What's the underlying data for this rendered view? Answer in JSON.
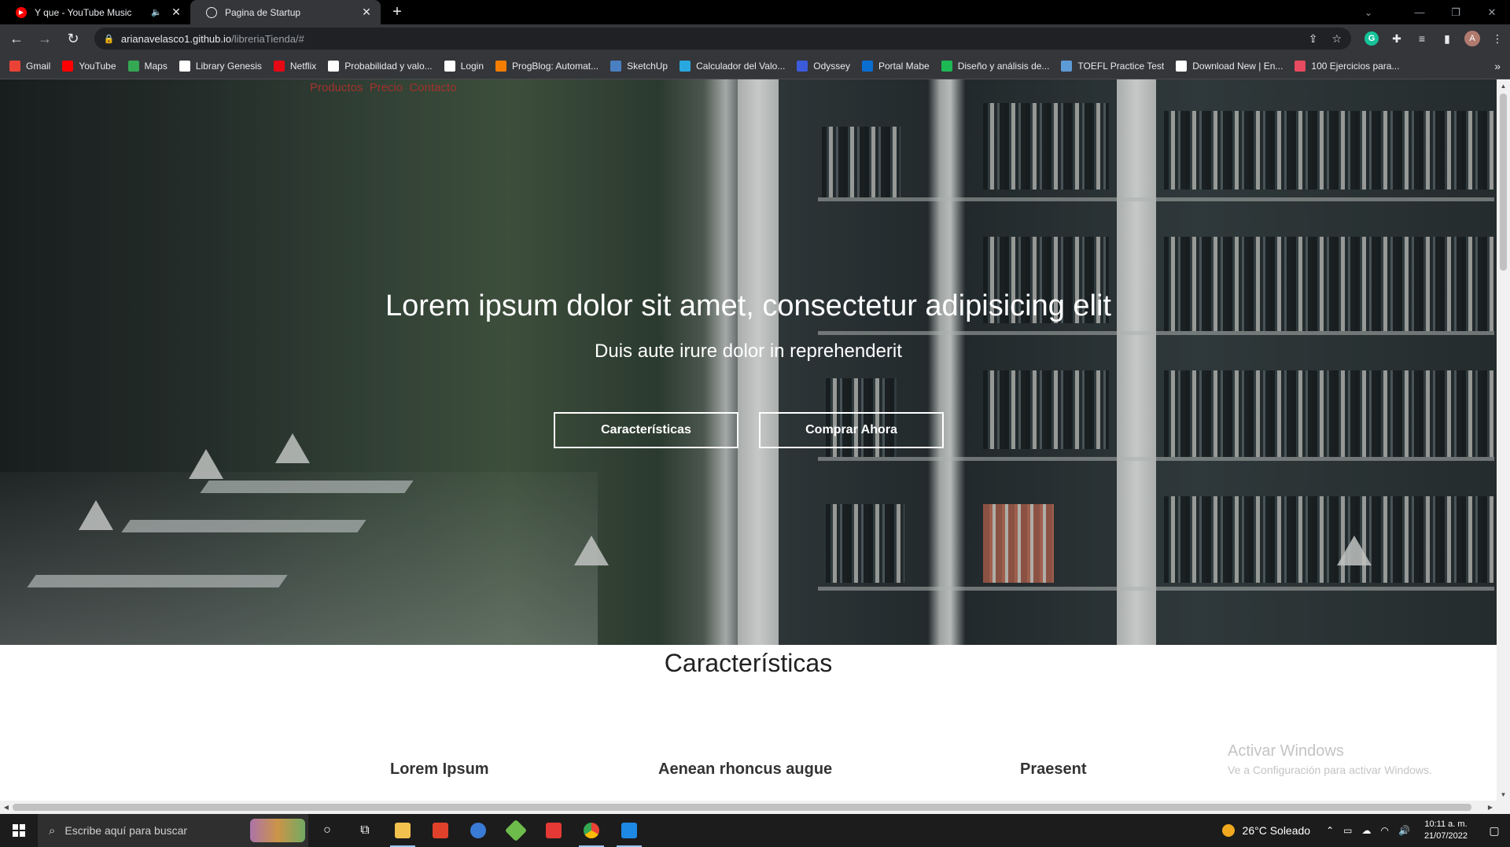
{
  "browser": {
    "tabs": [
      {
        "title": "Y que - YouTube Music",
        "favicon_color": "#ff0000",
        "audio": true
      },
      {
        "title": "Pagina de Startup",
        "favicon_color": "#e8eaed",
        "audio": false
      }
    ],
    "url_host": "arianavelasco1.github.io",
    "url_path": "/libreriaTienda/#",
    "bookmarks": [
      {
        "label": "Gmail",
        "icon": "gmail-icon",
        "color": "#ea4335"
      },
      {
        "label": "YouTube",
        "icon": "youtube-icon",
        "color": "#ff0000"
      },
      {
        "label": "Maps",
        "icon": "maps-icon",
        "color": "#34a853"
      },
      {
        "label": "Library Genesis",
        "icon": "library-genesis-icon",
        "color": "#ffffff"
      },
      {
        "label": "Netflix",
        "icon": "netflix-icon",
        "color": "#e50914"
      },
      {
        "label": "Probabilidad y valo...",
        "icon": "bookmark-page-icon",
        "color": "#ffffff"
      },
      {
        "label": "Login",
        "icon": "globe-icon",
        "color": "#ffffff"
      },
      {
        "label": "ProgBlog: Automat...",
        "icon": "blogger-icon",
        "color": "#f57d00"
      },
      {
        "label": "SketchUp",
        "icon": "sketchup-icon",
        "color": "#4a7fc1"
      },
      {
        "label": "Calculador del Valo...",
        "icon": "calculator-icon",
        "color": "#29a8e0"
      },
      {
        "label": "Odyssey",
        "icon": "odyssey-icon",
        "color": "#3b5bdb"
      },
      {
        "label": "Portal Mabe",
        "icon": "sap-icon",
        "color": "#0a6ed1"
      },
      {
        "label": "Diseño y análisis de...",
        "icon": "a-letter-icon",
        "color": "#1db954"
      },
      {
        "label": "TOEFL Practice Test",
        "icon": "toefl-icon",
        "color": "#5e9bd6"
      },
      {
        "label": "Download New | En...",
        "icon": "download-icon",
        "color": "#ffffff"
      },
      {
        "label": "100 Ejercicios para...",
        "icon": "exercise-icon",
        "color": "#e84a5f"
      }
    ],
    "profile_initial": "A",
    "extension_letter": "G"
  },
  "page": {
    "nav": [
      "Productos",
      "Precio",
      "Contacto"
    ],
    "hero_title": "Lorem ipsum dolor sit amet, consectetur adipisicing elit",
    "hero_subtitle": "Duis aute irure dolor in reprehenderit",
    "buttons": {
      "features": "Características",
      "buy": "Comprar Ahora"
    },
    "section_title": "Características",
    "features": [
      "Lorem Ipsum",
      "Aenean rhoncus augue",
      "Praesent"
    ]
  },
  "watermark": {
    "line1": "Activar Windows",
    "line2": "Ve a Configuración para activar Windows."
  },
  "taskbar": {
    "search_placeholder": "Escribe aquí para buscar",
    "weather": "26°C  Soleado",
    "time": "10:11 a. m.",
    "date": "21/07/2022"
  }
}
